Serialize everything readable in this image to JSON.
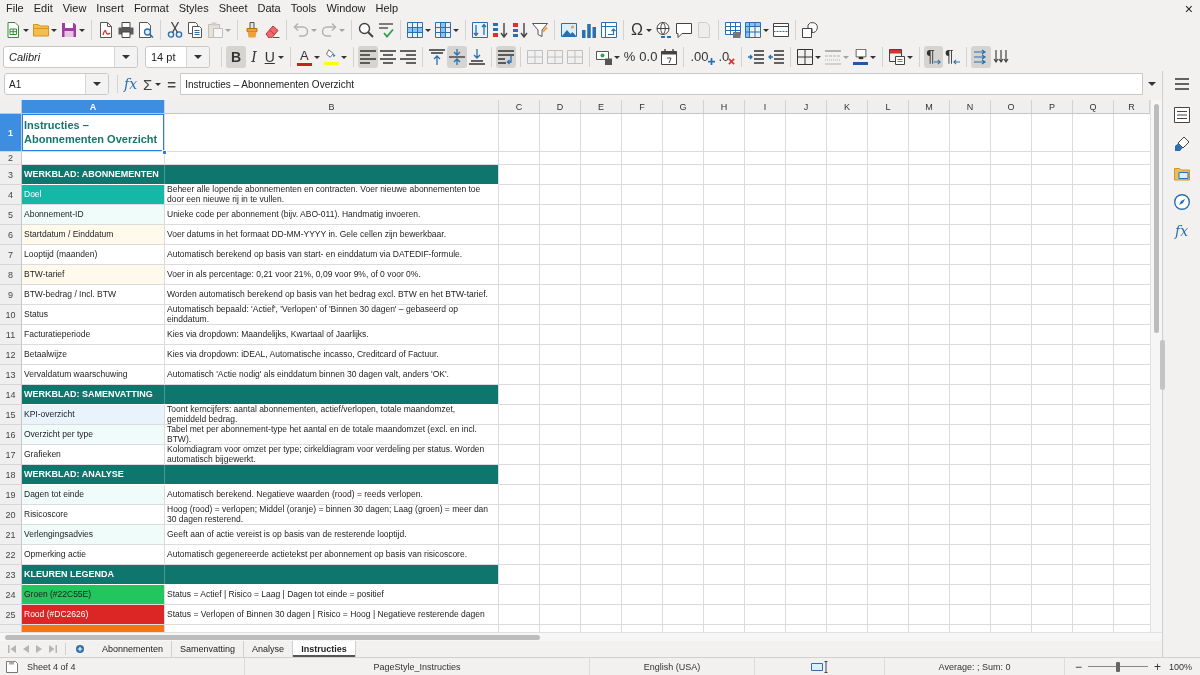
{
  "menu": [
    "File",
    "Edit",
    "View",
    "Insert",
    "Format",
    "Styles",
    "Sheet",
    "Data",
    "Tools",
    "Window",
    "Help"
  ],
  "document_close": "×",
  "standard_toolbar": [
    [
      {
        "kind": "new",
        "dropdown": true,
        "disabled": false
      },
      {
        "kind": "open",
        "dropdown": true,
        "disabled": false
      },
      {
        "kind": "save",
        "dropdown": true,
        "disabled": false
      }
    ],
    [
      {
        "kind": "pdf",
        "dropdown": false,
        "disabled": false
      },
      {
        "kind": "print",
        "dropdown": false,
        "disabled": false
      },
      {
        "kind": "preview",
        "dropdown": false,
        "disabled": false
      }
    ],
    [
      {
        "kind": "cut",
        "dropdown": false,
        "disabled": false
      },
      {
        "kind": "copy",
        "dropdown": false,
        "disabled": false
      },
      {
        "kind": "paste",
        "dropdown": true,
        "disabled": true
      }
    ],
    [
      {
        "kind": "clone",
        "dropdown": false,
        "disabled": false
      },
      {
        "kind": "clear",
        "dropdown": false,
        "disabled": false
      }
    ],
    [
      {
        "kind": "undo",
        "dropdown": true,
        "disabled": true
      },
      {
        "kind": "redo",
        "dropdown": true,
        "disabled": true
      }
    ],
    [
      {
        "kind": "find",
        "dropdown": false,
        "disabled": false
      },
      {
        "kind": "spelling",
        "dropdown": false,
        "disabled": false
      }
    ],
    [
      {
        "kind": "rows",
        "dropdown": true,
        "disabled": false
      },
      {
        "kind": "columns",
        "dropdown": true,
        "disabled": false
      }
    ],
    [
      {
        "kind": "sort",
        "dropdown": false,
        "disabled": false
      },
      {
        "kind": "sortup",
        "dropdown": false,
        "disabled": false
      },
      {
        "kind": "sortdown",
        "dropdown": false,
        "disabled": false
      },
      {
        "kind": "filter",
        "dropdown": false,
        "disabled": false
      }
    ],
    [
      {
        "kind": "image",
        "dropdown": false,
        "disabled": false
      },
      {
        "kind": "chart",
        "dropdown": false,
        "disabled": false
      },
      {
        "kind": "pivot",
        "dropdown": false,
        "disabled": false
      }
    ],
    [
      {
        "kind": "special",
        "label": "Ω",
        "dropdown": true,
        "disabled": false
      },
      {
        "kind": "link",
        "dropdown": false,
        "disabled": false
      },
      {
        "kind": "comment",
        "dropdown": false,
        "disabled": false
      },
      {
        "kind": "headers",
        "dropdown": false,
        "disabled": true
      }
    ],
    [
      {
        "kind": "printarea",
        "dropdown": false,
        "disabled": false
      },
      {
        "kind": "freeze",
        "dropdown": true,
        "disabled": false
      },
      {
        "kind": "split",
        "dropdown": false,
        "disabled": false
      }
    ],
    [
      {
        "kind": "draw",
        "dropdown": false,
        "disabled": false
      }
    ]
  ],
  "formatting_toolbar": {
    "font_name": "Calibri",
    "font_size": "14 pt",
    "groups": [
      [
        {
          "kind": "bold",
          "label": "B",
          "dropdown": false,
          "pressed": true,
          "disabled": false
        },
        {
          "kind": "italic",
          "label": "I",
          "dropdown": false,
          "pressed": false,
          "disabled": false
        },
        {
          "kind": "underline",
          "label": "U",
          "dropdown": true,
          "pressed": false,
          "disabled": false
        }
      ],
      [
        {
          "kind": "fontcolor",
          "label": "A",
          "color": "#c9211e",
          "dropdown": true,
          "pressed": false,
          "disabled": false
        },
        {
          "kind": "highlight",
          "color": "#ffff00",
          "dropdown": true,
          "pressed": false,
          "disabled": false
        }
      ],
      [
        {
          "kind": "alignleft",
          "dropdown": false,
          "pressed": true,
          "disabled": false
        },
        {
          "kind": "aligncenter",
          "dropdown": false,
          "pressed": false,
          "disabled": false
        },
        {
          "kind": "alignright",
          "dropdown": false,
          "pressed": false,
          "disabled": false
        }
      ],
      [
        {
          "kind": "aligntop",
          "dropdown": false,
          "pressed": false,
          "disabled": false
        },
        {
          "kind": "alignmiddle",
          "dropdown": false,
          "pressed": true,
          "disabled": false
        },
        {
          "kind": "alignbottom",
          "dropdown": false,
          "pressed": false,
          "disabled": false
        }
      ],
      [
        {
          "kind": "wrap",
          "dropdown": false,
          "pressed": true,
          "disabled": false
        }
      ],
      [
        {
          "kind": "mergecenter",
          "dropdown": false,
          "pressed": false,
          "disabled": true
        },
        {
          "kind": "merge",
          "dropdown": false,
          "pressed": false,
          "disabled": true
        },
        {
          "kind": "unmerge",
          "dropdown": false,
          "pressed": false,
          "disabled": true
        }
      ],
      [
        {
          "kind": "currency",
          "dropdown": true,
          "pressed": false,
          "disabled": false
        },
        {
          "kind": "percent",
          "label": "%",
          "dropdown": false,
          "pressed": false,
          "disabled": false
        },
        {
          "kind": "decimal",
          "label": "0.0",
          "dropdown": false,
          "pressed": false,
          "disabled": false
        },
        {
          "kind": "date",
          "dropdown": false,
          "pressed": false,
          "disabled": false
        }
      ],
      [
        {
          "kind": "adddecimal",
          "label": ".00",
          "dropdown": false,
          "pressed": false,
          "disabled": false
        },
        {
          "kind": "deldecimal",
          "label": ".0",
          "dropdown": false,
          "pressed": false,
          "disabled": false
        }
      ],
      [
        {
          "kind": "indent",
          "dropdown": false,
          "pressed": false,
          "disabled": false
        },
        {
          "kind": "outdent",
          "dropdown": false,
          "pressed": false,
          "disabled": false
        }
      ],
      [
        {
          "kind": "borders",
          "dropdown": true,
          "pressed": false,
          "disabled": false
        },
        {
          "kind": "borderstyle",
          "dropdown": true,
          "pressed": false,
          "disabled": true
        },
        {
          "kind": "bordercolor",
          "color": "#1e5aa8",
          "dropdown": true,
          "pressed": false,
          "disabled": false
        }
      ],
      [
        {
          "kind": "conditional",
          "dropdown": true,
          "pressed": false,
          "disabled": false
        }
      ],
      [
        {
          "kind": "ltr",
          "label": "¶",
          "dropdown": false,
          "pressed": true,
          "disabled": false
        },
        {
          "kind": "rtl",
          "label": "¶",
          "dropdown": false,
          "pressed": false,
          "disabled": false
        }
      ],
      [
        {
          "kind": "horizontal",
          "dropdown": false,
          "pressed": true,
          "disabled": false
        },
        {
          "kind": "vertical",
          "dropdown": false,
          "pressed": false,
          "disabled": false
        }
      ]
    ]
  },
  "formula_bar": {
    "name_box": "A1",
    "function_wizard": "fx",
    "sum": "Σ",
    "equals": "=",
    "content": "Instructies – Abonnementen Overzicht"
  },
  "sidebar": [
    {
      "kind": "properties"
    },
    {
      "kind": "styles"
    },
    {
      "kind": "gallery"
    },
    {
      "kind": "navigator"
    },
    {
      "kind": "functions",
      "label": "fx"
    }
  ],
  "columns": [
    {
      "label": "A",
      "selected": true
    },
    {
      "label": "B",
      "selected": false
    },
    {
      "label": "C",
      "selected": false
    },
    {
      "label": "D",
      "selected": false
    },
    {
      "label": "E",
      "selected": false
    },
    {
      "label": "F",
      "selected": false
    },
    {
      "label": "G",
      "selected": false
    },
    {
      "label": "H",
      "selected": false
    },
    {
      "label": "I",
      "selected": false
    },
    {
      "label": "J",
      "selected": false
    },
    {
      "label": "K",
      "selected": false
    },
    {
      "label": "L",
      "selected": false
    },
    {
      "label": "M",
      "selected": false
    },
    {
      "label": "N",
      "selected": false
    },
    {
      "label": "O",
      "selected": false
    },
    {
      "label": "P",
      "selected": false
    },
    {
      "label": "Q",
      "selected": false
    },
    {
      "label": "R",
      "selected": false
    }
  ],
  "rows": [
    {
      "number": "1",
      "selected": true,
      "kind": "title",
      "a": "Instructies – Abonnementen Overzicht"
    },
    {
      "number": "2",
      "selected": false,
      "kind": "blank"
    },
    {
      "number": "3",
      "selected": false,
      "kind": "section",
      "a": "WERKBLAD: ABONNEMENTEN"
    },
    {
      "number": "4",
      "selected": false,
      "kind": "accent",
      "a": "Doel",
      "color": "#14b8a6",
      "b": "Beheer alle lopende abonnementen en contracten. Voer nieuwe abonnementen toe door een nieuwe rij in te vullen."
    },
    {
      "number": "5",
      "selected": false,
      "kind": "item",
      "a": "Abonnement-ID",
      "color": "#effcfa",
      "b": "Unieke code per abonnement (bijv. ABO-011). Handmatig invoeren."
    },
    {
      "number": "6",
      "selected": false,
      "kind": "item",
      "a": "Startdatum / Einddatum",
      "color": "#fffaeb",
      "b": "Voer datums in het formaat DD-MM-YYYY in. Gele cellen zijn bewerkbaar."
    },
    {
      "number": "7",
      "selected": false,
      "kind": "item",
      "a": "Looptijd (maanden)",
      "b": "Automatisch berekend op basis van start- en einddatum via DATEDIF-formule."
    },
    {
      "number": "8",
      "selected": false,
      "kind": "item",
      "a": "BTW-tarief",
      "color": "#fffaeb",
      "b": "Voer in als percentage: 0,21 voor 21%, 0,09 voor 9%, of 0 voor 0%."
    },
    {
      "number": "9",
      "selected": false,
      "kind": "item",
      "a": "BTW-bedrag / Incl. BTW",
      "b": "Worden automatisch berekend op basis van het bedrag excl. BTW en het BTW-tarief."
    },
    {
      "number": "10",
      "selected": false,
      "kind": "item",
      "a": "Status",
      "b": "Automatisch bepaald: 'Actief', 'Verlopen' of 'Binnen 30 dagen' – gebaseerd op einddatum."
    },
    {
      "number": "11",
      "selected": false,
      "kind": "item",
      "a": "Facturatieperiode",
      "b": "Kies via dropdown: Maandelijks, Kwartaal of Jaarlijks."
    },
    {
      "number": "12",
      "selected": false,
      "kind": "item",
      "a": "Betaalwijze",
      "b": "Kies via dropdown: iDEAL, Automatische incasso, Creditcard of Factuur."
    },
    {
      "number": "13",
      "selected": false,
      "kind": "item",
      "a": "Vervaldatum waarschuwing",
      "b": "Automatisch 'Actie nodig' als einddatum binnen 30 dagen valt, anders 'OK'."
    },
    {
      "number": "14",
      "selected": false,
      "kind": "section",
      "a": "WERKBLAD: SAMENVATTING"
    },
    {
      "number": "15",
      "selected": false,
      "kind": "item",
      "a": "KPI-overzicht",
      "color": "#e8f3fc",
      "b": "Toont kerncijfers: aantal abonnementen, actief/verlopen, totale maandomzet, gemiddeld bedrag."
    },
    {
      "number": "16",
      "selected": false,
      "kind": "item",
      "a": "Overzicht per type",
      "color": "#effcfa",
      "b": "Tabel met per abonnement-type het aantal en de totale maandomzet (excl. en incl. BTW)."
    },
    {
      "number": "17",
      "selected": false,
      "kind": "item",
      "a": "Grafieken",
      "b": "Kolomdiagram voor omzet per type; cirkeldiagram voor verdeling per status. Worden automatisch bijgewerkt."
    },
    {
      "number": "18",
      "selected": false,
      "kind": "section",
      "a": "WERKBLAD: ANALYSE"
    },
    {
      "number": "19",
      "selected": false,
      "kind": "item",
      "a": "Dagen tot einde",
      "color": "#effcfa",
      "b": "Automatisch berekend. Negatieve waarden (rood) = reeds verlopen."
    },
    {
      "number": "20",
      "selected": false,
      "kind": "item",
      "a": "Risicoscore",
      "b": "Hoog (rood) = verlopen; Middel (oranje) = binnen 30 dagen; Laag (groen) = meer dan 30 dagen resterend."
    },
    {
      "number": "21",
      "selected": false,
      "kind": "item",
      "a": "Verlengingsadvies",
      "color": "#effcfa",
      "b": "Geeft aan of actie vereist is op basis van de resterende looptijd."
    },
    {
      "number": "22",
      "selected": false,
      "kind": "item",
      "a": "Opmerking actie",
      "b": "Automatisch gegenereerde actietekst per abonnement op basis van risicoscore."
    },
    {
      "number": "23",
      "selected": false,
      "kind": "section",
      "a": "KLEUREN LEGENDA"
    },
    {
      "number": "24",
      "selected": false,
      "kind": "item",
      "a": "Groen (#22C55E)",
      "color": "#22c55e",
      "b": "Status = Actief | Risico = Laag | Dagen tot einde = positief"
    },
    {
      "number": "25",
      "selected": false,
      "kind": "accent",
      "a": "Rood (#DC2626)",
      "color": "#dc2626",
      "b": "Status = Verlopen of Binnen 30 dagen | Risico = Hoog | Negatieve resterende dagen"
    },
    {
      "selected": false,
      "kind": "cut",
      "color": "#f97316"
    }
  ],
  "sheet_nav": {
    "disabled": true
  },
  "sheet_tabs": [
    {
      "label": "Abonnementen",
      "selected": false
    },
    {
      "label": "Samenvatting",
      "selected": false
    },
    {
      "label": "Analyse",
      "selected": false
    },
    {
      "label": "Instructies",
      "selected": true
    }
  ],
  "status_bar": {
    "sheet": "Sheet 4 of 4",
    "page_style": "PageStyle_Instructies",
    "language": "English (USA)",
    "aggregate": "Average: ; Sum: 0",
    "zoom_out": "−",
    "zoom": {
      "level": 0.5
    },
    "zoom_in": "+",
    "zoom_label": "100%"
  }
}
